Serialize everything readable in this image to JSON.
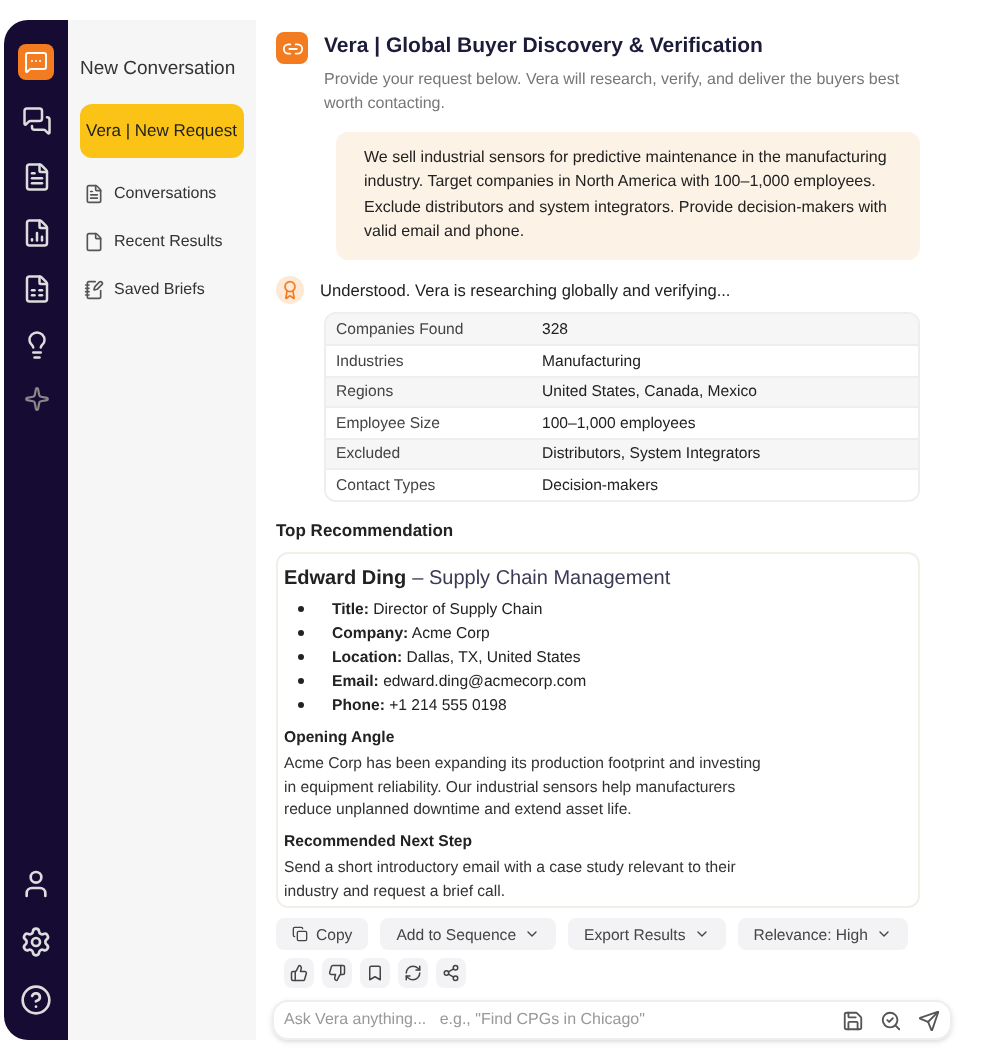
{
  "sidebar": {
    "title": "New Conversation",
    "items": [
      {
        "label": "Vera | New Request",
        "selected": true
      },
      {
        "label": "Conversations",
        "selected": false
      },
      {
        "label": "Recent Results",
        "selected": false
      },
      {
        "label": "Saved Briefs",
        "selected": false
      }
    ]
  },
  "header": {
    "title": "Vera | Global Buyer Discovery & Verification",
    "subtitle": "Provide your request below. Vera will research, verify, and deliver the buyers best worth contacting."
  },
  "user_message": "We sell industrial sensors for predictive maintenance in the manufacturing industry. Target companies in North America with 100–1,000 employees. Exclude distributors and system integrators. Provide decision-makers with valid email and phone.",
  "assistant_status": "Understood. Vera is researching globally and verifying...",
  "summary_table": [
    {
      "label": "Companies Found",
      "value": "328"
    },
    {
      "label": "Industries",
      "value": "Manufacturing"
    },
    {
      "label": "Regions",
      "value": "United States, Canada, Mexico"
    },
    {
      "label": "Employee Size",
      "value": "100–1,000 employees"
    },
    {
      "label": "Excluded",
      "value": "Distributors, System Integrators"
    },
    {
      "label": "Contact Types",
      "value": "Decision-makers"
    }
  ],
  "recommendation": {
    "heading": "Top Recommendation",
    "name": "Edward Ding",
    "department": "– Supply Chain Management",
    "details": [
      {
        "label": "Title:",
        "value": "Director of Supply Chain"
      },
      {
        "label": "Company:",
        "value": "Acme Corp"
      },
      {
        "label": "Location:",
        "value": "Dallas, TX, United States"
      },
      {
        "label": "Email:",
        "value": "edward.ding@acmecorp.com"
      },
      {
        "label": "Phone:",
        "value": "+1 214 555 0198"
      }
    ],
    "sections": [
      {
        "heading": "Opening Angle",
        "text": "Acme Corp has been expanding its production footprint and investing in equipment reliability. Our industrial sensors help manufacturers reduce unplanned downtime and extend asset life."
      },
      {
        "heading": "Recommended Next Step",
        "text": "Send a short introductory email with a case study relevant to their industry and request a brief call."
      }
    ]
  },
  "actions": [
    {
      "label": "Copy",
      "kind": "copy"
    },
    {
      "label": "Add to Sequence",
      "kind": "dropdown"
    },
    {
      "label": "Export Results",
      "kind": "dropdown"
    },
    {
      "label": "Relevance: High",
      "kind": "dropdown"
    }
  ],
  "composer": {
    "placeholder": "Ask Vera anything...   e.g., \"Find CPGs in Chicago\""
  }
}
